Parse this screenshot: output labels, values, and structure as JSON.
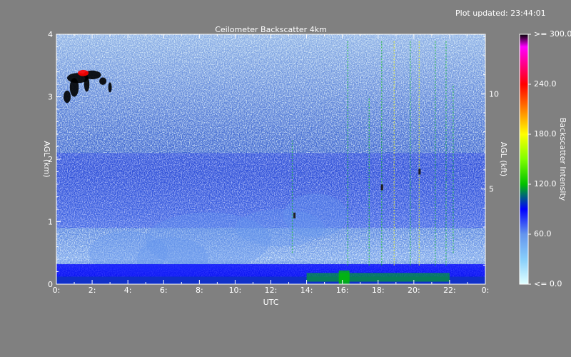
{
  "plot_updated": "Plot updated: 23:44:01",
  "chart_data": {
    "type": "heatmap",
    "title": "Ceilometer Backscatter 4km",
    "xlabel": "UTC",
    "ylabel_left": "AGL (km)",
    "ylabel_right": "AGL (kft)",
    "colorbar_label": "Backscatter Intensity",
    "xlim": [
      0,
      24
    ],
    "ylim_km": [
      0,
      4
    ],
    "x_ticks": [
      0,
      2,
      4,
      6,
      8,
      10,
      12,
      14,
      16,
      18,
      20,
      22,
      24
    ],
    "x_tick_labels": [
      "0:",
      "2:",
      "4:",
      "6:",
      "8:",
      "10:",
      "12:",
      "14:",
      "16:",
      "18:",
      "20:",
      "22:",
      "0:"
    ],
    "y_left_ticks": [
      0,
      1,
      2,
      3,
      4
    ],
    "y_left_tick_labels": [
      "0",
      "1",
      "2",
      "3",
      "4"
    ],
    "y_right_ticks_kft": [
      5,
      10
    ],
    "y_right_tick_labels": [
      "5",
      "10"
    ],
    "colorbar_range": [
      0,
      300
    ],
    "colorbar_ticks": [
      0,
      60,
      120,
      180,
      240,
      300
    ],
    "colorbar_tick_labels": [
      "<= 0.0",
      "60.0",
      "120.0",
      "180.0",
      "240.0",
      ">= 300.0"
    ],
    "colors": {
      "low": "#e0ffff",
      "mid_low": "#6495ed",
      "mid": "#0000ff",
      "green": "#00c000",
      "yellow": "#ffff00",
      "orange": "#ff8000",
      "red": "#ff0000",
      "magenta": "#ff00ff",
      "max": "#000000"
    }
  }
}
